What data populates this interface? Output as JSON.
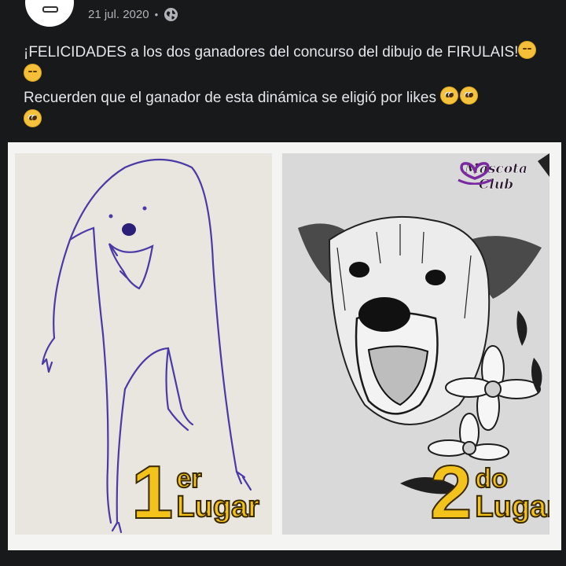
{
  "post": {
    "date": "21 jul. 2020",
    "separator": "•",
    "privacy_icon": "globe-icon",
    "line1": "¡FELICIDADES a los dos ganadores del concurso del dibujo de FIRULAIS!",
    "line2": "Recuerden que el ganador de esta dinámica se eligió por likes"
  },
  "image": {
    "first_place": {
      "number": "1",
      "suffix": "er",
      "word": "Lugar"
    },
    "second_place": {
      "number": "2",
      "suffix": "do",
      "word": "Lugar"
    },
    "brand": "Mascota Club",
    "label_color": "#f3c21b"
  },
  "colors": {
    "background": "#18191a",
    "text": "#e4e6eb",
    "meta": "#b0b3b8"
  }
}
